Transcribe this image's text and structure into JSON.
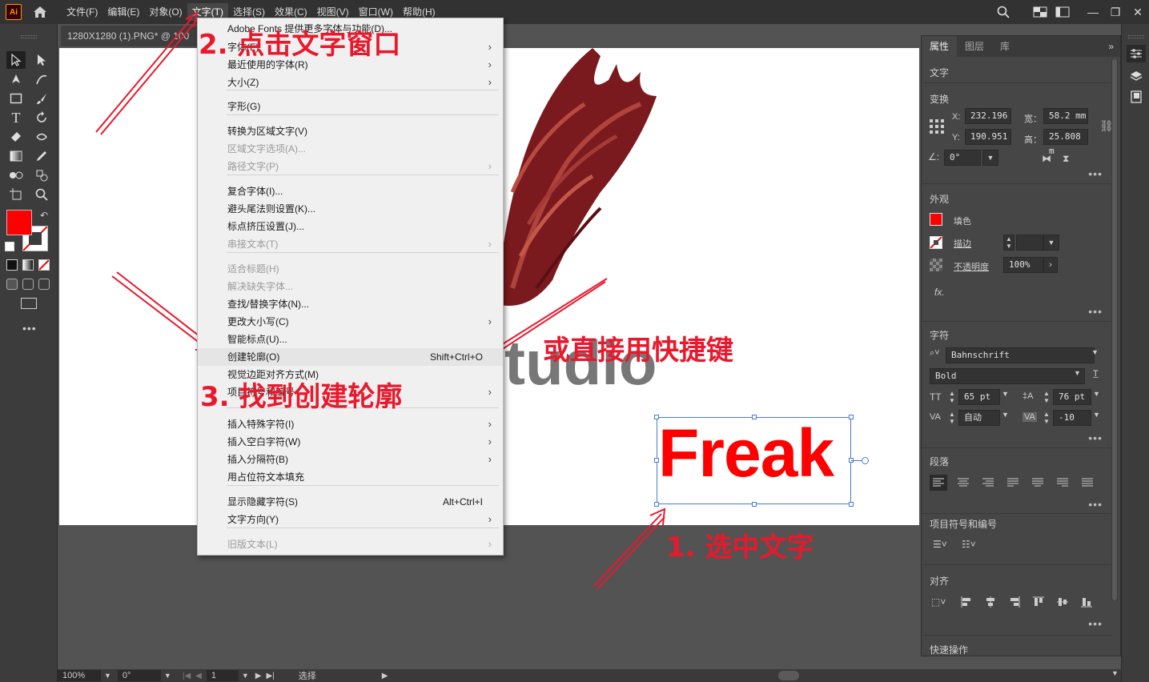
{
  "app": {
    "logo": "Ai",
    "menu": [
      "文件(F)",
      "编辑(E)",
      "对象(O)",
      "文字(T)",
      "选择(S)",
      "效果(C)",
      "视图(V)",
      "窗口(W)",
      "帮助(H)"
    ],
    "active_menu_index": 3
  },
  "document": {
    "tab_title": "1280X1280 (1).PNG* @ 100"
  },
  "dropdown": {
    "items": [
      {
        "label": "Adobe Fonts 提供更多字体与功能(D)...",
        "disabled": false,
        "arrow": false,
        "shortcut": ""
      },
      {
        "label": "字体(F)",
        "disabled": false,
        "arrow": true,
        "shortcut": ""
      },
      {
        "label": "最近使用的字体(R)",
        "disabled": false,
        "arrow": true,
        "shortcut": ""
      },
      {
        "label": "大小(Z)",
        "disabled": false,
        "arrow": true,
        "shortcut": ""
      },
      {
        "label": "字形(G)",
        "disabled": false,
        "arrow": false,
        "shortcut": ""
      },
      {
        "label": "转换为区域文字(V)",
        "disabled": false,
        "arrow": false,
        "shortcut": ""
      },
      {
        "label": "区域文字选项(A)...",
        "disabled": true,
        "arrow": false,
        "shortcut": ""
      },
      {
        "label": "路径文字(P)",
        "disabled": true,
        "arrow": true,
        "shortcut": ""
      },
      {
        "label": "复合字体(I)...",
        "disabled": false,
        "arrow": false,
        "shortcut": ""
      },
      {
        "label": "避头尾法则设置(K)...",
        "disabled": false,
        "arrow": false,
        "shortcut": ""
      },
      {
        "label": "标点挤压设置(J)...",
        "disabled": false,
        "arrow": false,
        "shortcut": ""
      },
      {
        "label": "串接文本(T)",
        "disabled": true,
        "arrow": true,
        "shortcut": ""
      },
      {
        "label": "适合标题(H)",
        "disabled": true,
        "arrow": false,
        "shortcut": ""
      },
      {
        "label": "解决缺失字体...",
        "disabled": true,
        "arrow": false,
        "shortcut": ""
      },
      {
        "label": "查找/替换字体(N)...",
        "disabled": false,
        "arrow": false,
        "shortcut": ""
      },
      {
        "label": "更改大小写(C)",
        "disabled": false,
        "arrow": true,
        "shortcut": ""
      },
      {
        "label": "智能标点(U)...",
        "disabled": false,
        "arrow": false,
        "shortcut": ""
      },
      {
        "label": "创建轮廓(O)",
        "disabled": false,
        "arrow": false,
        "shortcut": "Shift+Ctrl+O"
      },
      {
        "label": "视觉边距对齐方式(M)",
        "disabled": false,
        "arrow": false,
        "shortcut": ""
      },
      {
        "label": "项目符号和编号",
        "disabled": false,
        "arrow": true,
        "shortcut": ""
      },
      {
        "label": "插入特殊字符(I)",
        "disabled": false,
        "arrow": true,
        "shortcut": ""
      },
      {
        "label": "插入空白字符(W)",
        "disabled": false,
        "arrow": true,
        "shortcut": ""
      },
      {
        "label": "插入分隔符(B)",
        "disabled": false,
        "arrow": true,
        "shortcut": ""
      },
      {
        "label": "用占位符文本填充",
        "disabled": false,
        "arrow": false,
        "shortcut": ""
      },
      {
        "label": "显示隐藏字符(S)",
        "disabled": false,
        "arrow": false,
        "shortcut": "Alt+Ctrl+I"
      },
      {
        "label": "文字方向(Y)",
        "disabled": false,
        "arrow": true,
        "shortcut": ""
      },
      {
        "label": "旧版文本(L)",
        "disabled": true,
        "arrow": true,
        "shortcut": ""
      }
    ],
    "highlight_index": 17
  },
  "artboard": {
    "text_freak": "Freak",
    "text_tudio": "tudio",
    "freak_color": "#ff0000"
  },
  "annotations": {
    "step1": "1. 选中文字",
    "step2": "2. 点击文字窗口",
    "step3": "3. 找到创建轮廓",
    "shortcut_hint": "或直接用快捷键",
    "color": "#e8192c"
  },
  "panel": {
    "tabs": [
      "属性",
      "图层",
      "库"
    ],
    "section_text": "文字",
    "section_transform": "变换",
    "x_label": "X:",
    "x_value": "232.196",
    "y_label": "Y:",
    "y_value": "190.951",
    "w_label": "宽：",
    "w_value": "58.2 mm",
    "h_label": "高：",
    "h_value": "25.808 m",
    "angle_value": "0°",
    "section_appearance": "外观",
    "fill_label": "填色",
    "stroke_label": "描边",
    "opacity_label": "不透明度",
    "opacity_value": "100%",
    "fx_label": "fx.",
    "section_character": "字符",
    "font_family": "Bahnschrift",
    "font_style": "Bold",
    "font_size": "65 pt",
    "leading": "76 pt",
    "kerning": "自动",
    "tracking": "-10",
    "section_paragraph": "段落",
    "section_bullets": "项目符号和编号",
    "section_align": "对齐",
    "section_quick": "快速操作"
  },
  "status": {
    "zoom": "100%",
    "rotation": "0°",
    "page": "1",
    "tool": "选择"
  }
}
